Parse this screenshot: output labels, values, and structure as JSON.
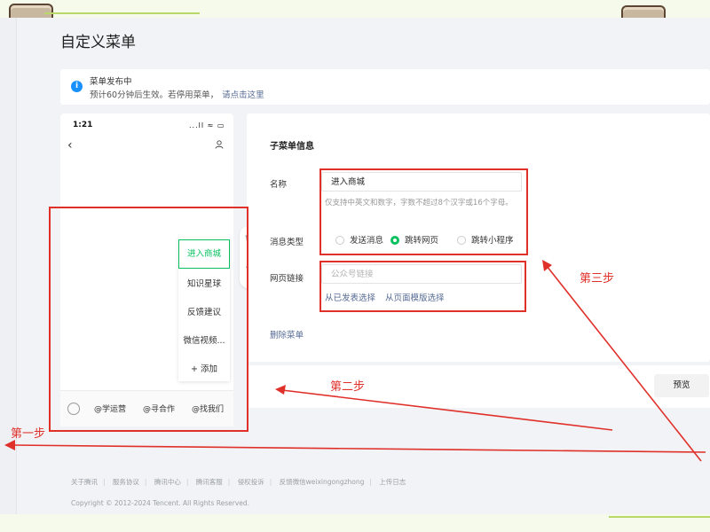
{
  "page_title": "自定义菜单",
  "notice": {
    "icon": "info-icon",
    "line1": "菜单发布中",
    "line2": "预计60分钟后生效。若停用菜单，",
    "link": "请点击这里"
  },
  "phone": {
    "time": "1:21",
    "status_icons": "...ll ≈ ▭",
    "submenu": [
      "进入商城",
      "知识星球",
      "反馈建议",
      "微信视频...",
      "+ 添加"
    ],
    "bottom_menu": [
      "@学运营",
      "@寻合作",
      "@找我们"
    ]
  },
  "panel": {
    "heading": "子菜单信息",
    "name_label": "名称",
    "name_value": "进入商城",
    "name_hint": "仅支持中英文和数字，字数不超过8个汉字或16个字母。",
    "msg_type_label": "消息类型",
    "msg_types": [
      "发送消息",
      "跳转网页",
      "跳转小程序"
    ],
    "selected_type": "跳转网页",
    "url_label": "网页链接",
    "url_placeholder": "公众号链接",
    "url_links": [
      "从已发表选择",
      "从页面模版选择"
    ],
    "delete_label": "删除菜单",
    "preview_label": "预览"
  },
  "annotations": {
    "step1": "第一步",
    "step2": "第二步",
    "step3": "第三步",
    "accent": "#e0302a"
  },
  "footer": {
    "links": [
      "关于腾讯",
      "服务协议",
      "腾讯中心",
      "腾讯客服",
      "侵权投诉",
      "反馈微信weixingongzhong",
      "上传日志"
    ],
    "copyright": "Copyright © 2012-2024 Tencent. All Rights Reserved."
  }
}
